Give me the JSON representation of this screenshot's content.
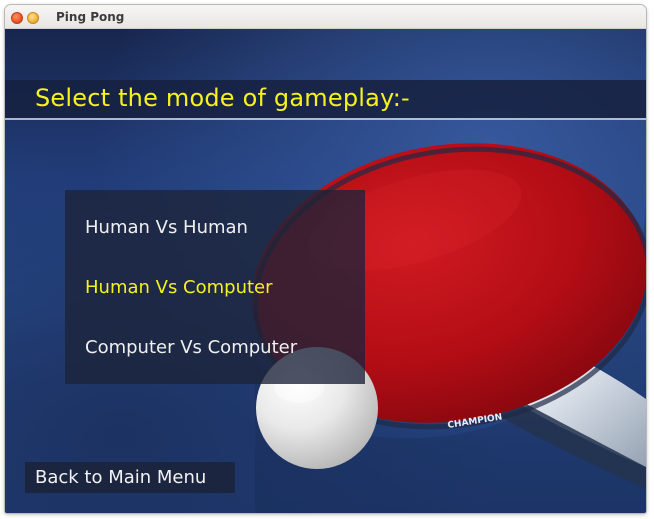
{
  "window": {
    "title": "Ping Pong"
  },
  "header": {
    "title": "Select the mode of gameplay:-"
  },
  "mode_menu": {
    "options": [
      {
        "label": "Human Vs Human",
        "highlighted": false
      },
      {
        "label": "Human Vs Computer",
        "highlighted": true
      },
      {
        "label": "Computer Vs Computer",
        "highlighted": false
      }
    ]
  },
  "background_art": {
    "paddle_brand": "CHAMPION"
  },
  "footer": {
    "back_button_label": "Back to Main Menu"
  },
  "colors": {
    "highlight": "#f6f21c",
    "text": "#f0f0f0",
    "panel": "#1c2339",
    "background": "#223e7c",
    "paddle_red": "#b50e16"
  }
}
